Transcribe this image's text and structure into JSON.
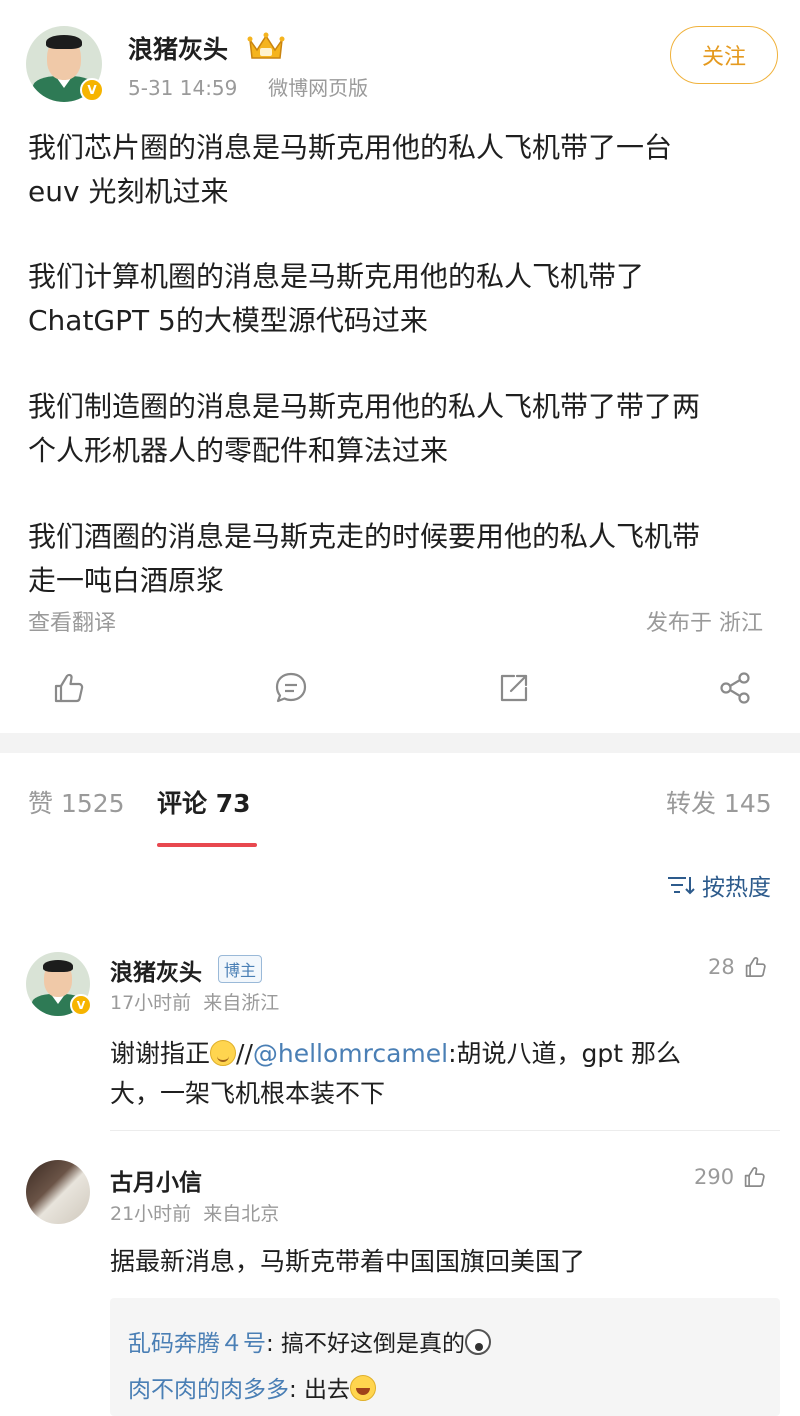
{
  "post": {
    "author_name": "浪猪灰头",
    "time": "5-31 14:59",
    "source": "微博网页版",
    "follow_label": "关注",
    "paragraphs": [
      "我们芯片圈的消息是马斯克用他的私人飞机带了一台\neuv 光刻机过来",
      "我们计算机圈的消息是马斯克用他的私人飞机带了\nChatGPT 5的大模型源代码过来",
      "我们制造圈的消息是马斯克用他的私人飞机带了带了两\n个人形机器人的零配件和算法过来",
      "我们酒圈的消息是马斯克走的时候要用他的私人飞机带\n走一吨白酒原浆"
    ],
    "translate_label": "查看翻译",
    "location_label": "发布于 浙江"
  },
  "actions": {
    "like_icon": "thumbs-up-icon",
    "comment_icon": "comment-bubble-icon",
    "repost_icon": "share-arrow-icon",
    "share_icon": "share-nodes-icon"
  },
  "tabs": {
    "likes_label": "赞 1525",
    "comments_label": "评论 73",
    "reposts_label": "转发 145"
  },
  "sort_label": "按热度",
  "comments": [
    {
      "name": "浪猪灰头",
      "tag": "博主",
      "meta": "17小时前  来自浙江",
      "likes": "28",
      "text_prefix": "谢谢指正",
      "text_sep": "//",
      "mention": "@hellomrcamel",
      "text_after": ":胡说八道，gpt 那么",
      "text_line2": "大，一架飞机根本装不下"
    },
    {
      "name": "古月小信",
      "meta": "21小时前  来自北京",
      "likes": "290",
      "text": "据最新消息，马斯克带着中国国旗回美国了",
      "replies": [
        {
          "user": "乱码奔腾４号",
          "text": ": 搞不好这倒是真的"
        },
        {
          "user": "肉不肉的肉多多",
          "text": ": 出去"
        }
      ]
    }
  ]
}
